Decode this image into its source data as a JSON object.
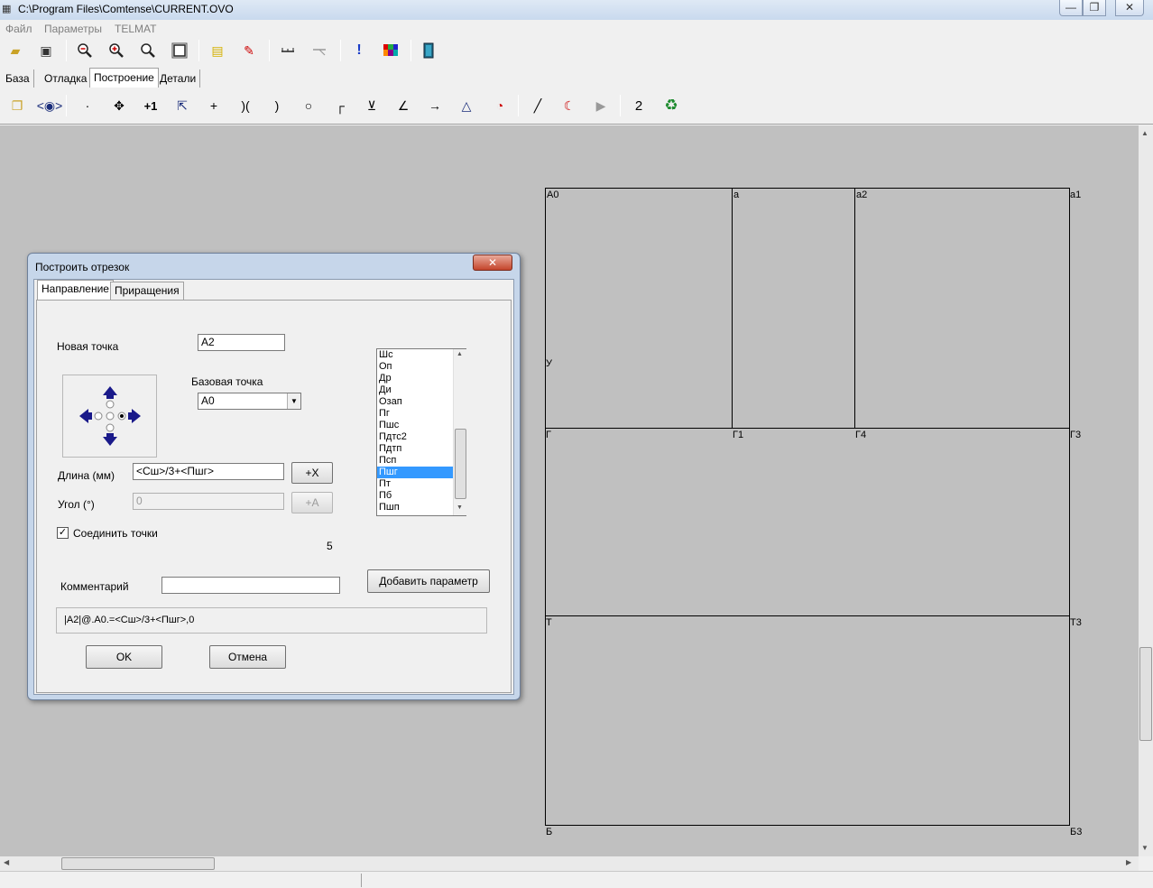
{
  "window": {
    "title": "C:\\Program Files\\Comtense\\CURRENT.OVO",
    "minimize_glyph": "—",
    "maximize_glyph": "❐",
    "close_glyph": "✕"
  },
  "menu": {
    "items": [
      "Файл",
      "Параметры",
      "TELMAT"
    ]
  },
  "main_tabs": [
    "База",
    "Отладка",
    "Построение",
    "Детали"
  ],
  "toolbar2": {
    "counter_label": "2"
  },
  "canvas": {
    "point_labels": [
      "А0",
      "а",
      "а2",
      "а1",
      "У",
      "Г",
      "Г1",
      "Г4",
      "Г3",
      "Т",
      "Т3",
      "Б",
      "Б3"
    ]
  },
  "dialog": {
    "title": "Построить отрезок",
    "close_glyph": "✕",
    "tabs": [
      "Направление",
      "Приращения"
    ],
    "new_point_label": "Новая точка",
    "new_point_value": "А2",
    "base_point_label": "Базовая точка",
    "base_point_value": "А0",
    "length_label": "Длина (мм)",
    "length_value": "<Сш>/3+<Пшг>",
    "add_x_button": "+X",
    "angle_label": "Угол (°)",
    "angle_value": "0",
    "add_a_button": "+A",
    "connect_label": "Соединить точки",
    "connect_checked": true,
    "count_value": "5",
    "comment_label": "Комментарий",
    "comment_value": "",
    "add_param_button": "Добавить параметр",
    "formula": "|А2|@.А0.=<Сш>/3+<Пшг>,0",
    "ok_button": "OK",
    "cancel_button": "Отмена",
    "params_list": [
      "Шс",
      "Оп",
      "Др",
      "Ди",
      "Озап",
      "Пг",
      "Пшс",
      "Пдтс2",
      "Пдтп",
      "Псп",
      "Пшг",
      "Пт",
      "Пб",
      "Пшп"
    ],
    "params_selected": "Пшг"
  }
}
